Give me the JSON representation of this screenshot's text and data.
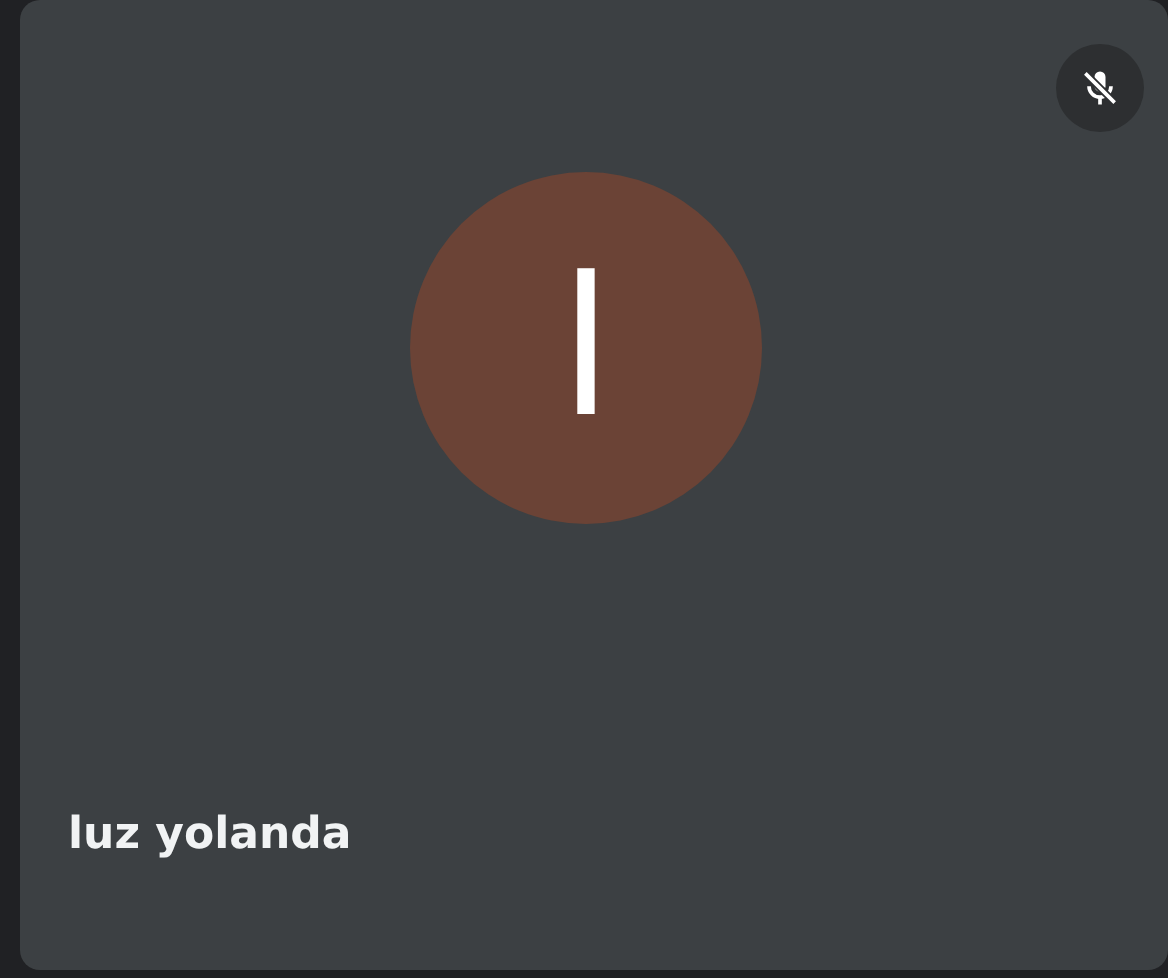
{
  "participant": {
    "name": "luz yolanda",
    "initial": "l",
    "muted": true
  }
}
